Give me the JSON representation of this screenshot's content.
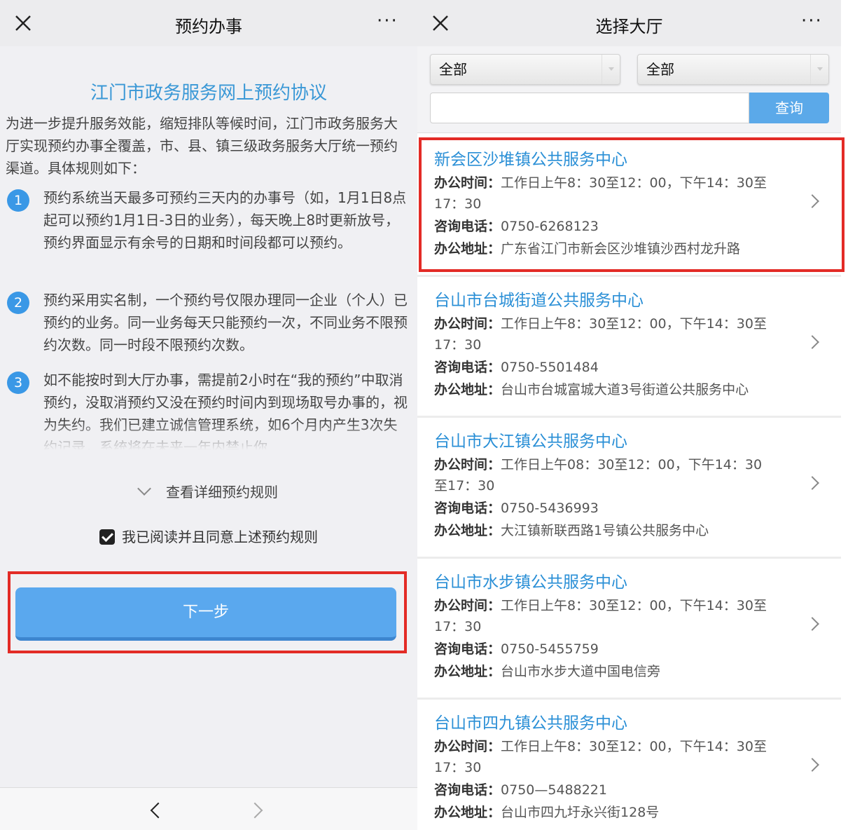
{
  "left": {
    "header": {
      "title": "预约办事",
      "more": "···"
    },
    "doc_title": "江门市政务服务网上预约协议",
    "intro": "为进一步提升服务效能，缩短排队等候时间，江门市政务服务大厅实现预约办事全覆盖，市、县、镇三级政务服务大厅统一预约渠道。具体规则如下：",
    "rules": [
      {
        "num": "1",
        "text": "预约系统当天最多可预约三天内的办事号（如，1月1日8点起可以预约1月1日-3日的业务），每天晚上8时更新放号，预约界面显示有余号的日期和时间段都可以预约。"
      },
      {
        "num": "2",
        "text": "预约采用实名制，一个预约号仅限办理同一企业（个人）已预约的业务。同一业务每天只能预约一次，不同业务不限预约次数。同一时段不限预约次数。"
      },
      {
        "num": "3",
        "text": "如不能按时到大厅办事，需提前2小时在“我的预约”中取消预约，没取消预约又没在预约时间内到现场取号办事的，视为失约。我们已建立诚信管理系统，如6个月内产生3次失约记录，系统将在未来一年内禁止你"
      }
    ],
    "detail_link": "查看详细预约规则",
    "agree_text": "我已阅读并且同意上述预约规则",
    "next_button": "下一步"
  },
  "right": {
    "header": {
      "title": "选择大厅",
      "more": "···"
    },
    "filters": {
      "select1": "全部",
      "select2": "全部",
      "search_value": "",
      "query_button": "查询"
    },
    "labels": {
      "hours": "办公时间：",
      "phone": "咨询电话：",
      "address": "办公地址："
    },
    "halls": [
      {
        "name": "新会区沙堆镇公共服务中心",
        "hours1": "工作日上午8：30至12：00，下午14：30至",
        "hours2": "17：30",
        "phone": "0750-6268123",
        "address": "广东省江门市新会区沙堆镇沙西村龙升路"
      },
      {
        "name": "台山市台城街道公共服务中心",
        "hours1": "工作日上午8：30至12：00，下午14：30至",
        "hours2": "17：30",
        "phone": "0750-5501484",
        "address": "台山市台城富城大道3号街道公共服务中心"
      },
      {
        "name": "台山市大江镇公共服务中心",
        "hours1": "工作日上午08：30至12：00，下午14：30",
        "hours2": "至17：30",
        "phone": "0750-5436993",
        "address": "大江镇新联西路1号镇公共服务中心"
      },
      {
        "name": "台山市水步镇公共服务中心",
        "hours1": "工作日上午8：30至12：00，下午14：30至",
        "hours2": "17：30",
        "phone": "0750-5455759",
        "address": "台山市水步大道中国电信旁"
      },
      {
        "name": "台山市四九镇公共服务中心",
        "hours1": "工作日上午8：30至12：00，下午14：30至",
        "hours2": "17：30",
        "phone": "0750—5488221",
        "address": "台山市四九圩永兴街128号"
      }
    ]
  },
  "colors": {
    "accent_blue": "#2a8fd6",
    "button_blue": "#5aa8ee",
    "highlight_red": "#e32b26"
  }
}
